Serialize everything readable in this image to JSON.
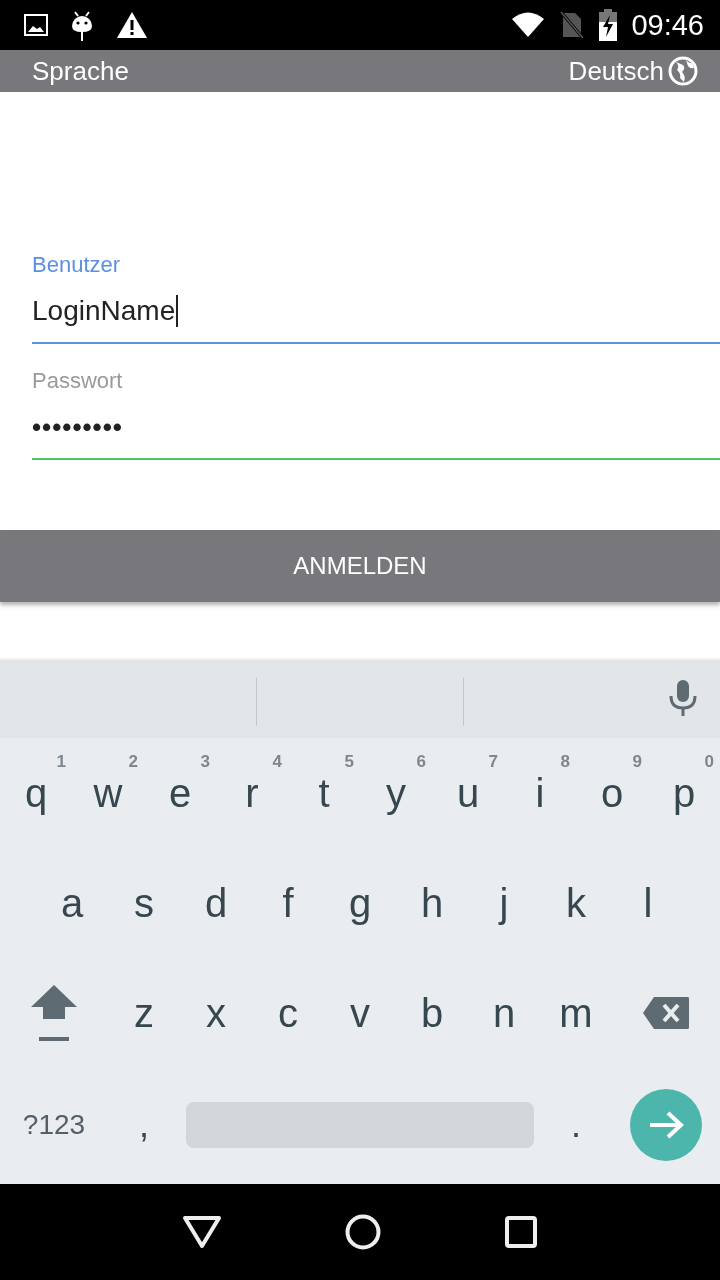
{
  "status_bar": {
    "time": "09:46"
  },
  "toolbar": {
    "title": "Sprache",
    "language": "Deutsch"
  },
  "fields": [
    {
      "label": "Benutzer",
      "value": "LoginName",
      "focused": true,
      "color": "#5b8fe0"
    },
    {
      "label": "Passwort",
      "value": "•••••••••",
      "focused": false,
      "color": "#4cc764"
    }
  ],
  "login_button": "ANMELDEN",
  "keyboard": {
    "rows": [
      {
        "keys": [
          {
            "kind": "letter",
            "label": "q",
            "hint": "1"
          },
          {
            "kind": "letter",
            "label": "w",
            "hint": "2"
          },
          {
            "kind": "letter",
            "label": "e",
            "hint": "3"
          },
          {
            "kind": "letter",
            "label": "r",
            "hint": "4"
          },
          {
            "kind": "letter",
            "label": "t",
            "hint": "5"
          },
          {
            "kind": "letter",
            "label": "y",
            "hint": "6"
          },
          {
            "kind": "letter",
            "label": "u",
            "hint": "7"
          },
          {
            "kind": "letter",
            "label": "i",
            "hint": "8"
          },
          {
            "kind": "letter",
            "label": "o",
            "hint": "9"
          },
          {
            "kind": "letter",
            "label": "p",
            "hint": "0"
          }
        ]
      },
      {
        "keys": [
          {
            "kind": "letter",
            "label": "a"
          },
          {
            "kind": "letter",
            "label": "s"
          },
          {
            "kind": "letter",
            "label": "d"
          },
          {
            "kind": "letter",
            "label": "f"
          },
          {
            "kind": "letter",
            "label": "g"
          },
          {
            "kind": "letter",
            "label": "h"
          },
          {
            "kind": "letter",
            "label": "j"
          },
          {
            "kind": "letter",
            "label": "k"
          },
          {
            "kind": "letter",
            "label": "l"
          }
        ]
      },
      {
        "keys": [
          {
            "kind": "shift"
          },
          {
            "kind": "letter",
            "label": "z"
          },
          {
            "kind": "letter",
            "label": "x"
          },
          {
            "kind": "letter",
            "label": "c"
          },
          {
            "kind": "letter",
            "label": "v"
          },
          {
            "kind": "letter",
            "label": "b"
          },
          {
            "kind": "letter",
            "label": "n"
          },
          {
            "kind": "letter",
            "label": "m"
          },
          {
            "kind": "backspace"
          }
        ]
      },
      {
        "keys": [
          {
            "kind": "symbols",
            "label": "?123"
          },
          {
            "kind": "punct",
            "label": ","
          },
          {
            "kind": "space"
          },
          {
            "kind": "punct",
            "label": "."
          },
          {
            "kind": "enter"
          }
        ]
      }
    ]
  }
}
